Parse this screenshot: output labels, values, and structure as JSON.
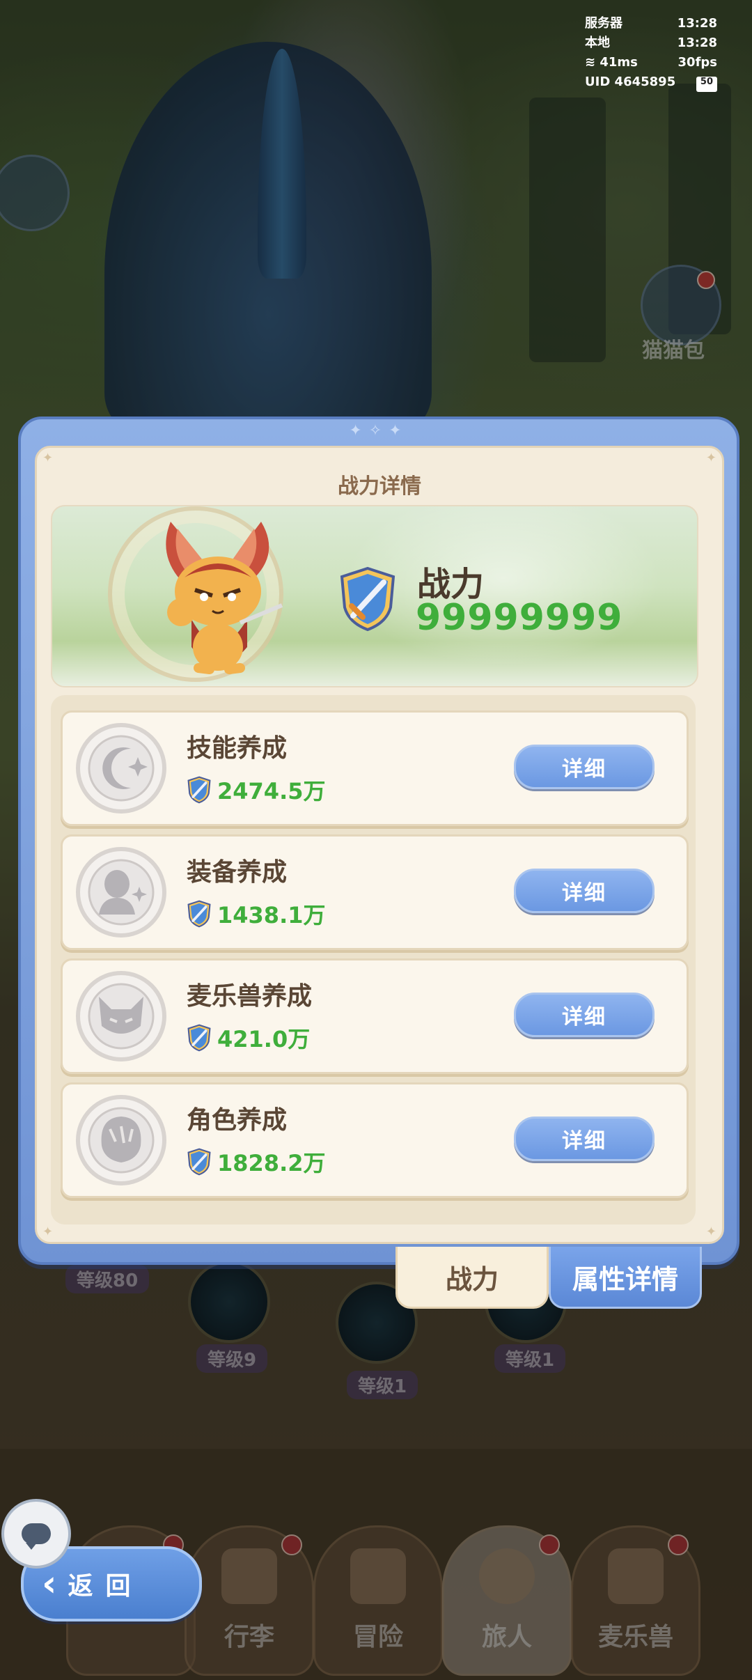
{
  "status": {
    "server_label": "服务器",
    "server_time": "13:28",
    "local_label": "本地",
    "local_time": "13:28",
    "ping": "41ms",
    "fps": "30fps",
    "uid_label": "UID",
    "uid": "4645895",
    "battery": "50"
  },
  "side": {
    "cat_bag_label": "猫猫包"
  },
  "panel": {
    "title": "战力详情",
    "power_label": "战力",
    "power_value": "99999999",
    "items": [
      {
        "name": "技能养成",
        "value": "2474.5万",
        "button": "详细",
        "icon": "moon-star-icon"
      },
      {
        "name": "装备养成",
        "value": "1438.1万",
        "button": "详细",
        "icon": "figure-sparkle-icon"
      },
      {
        "name": "麦乐兽养成",
        "value": "421.0万",
        "button": "详细",
        "icon": "fox-face-icon"
      },
      {
        "name": "角色养成",
        "value": "1828.2万",
        "button": "详细",
        "icon": "character-hair-icon"
      }
    ]
  },
  "tabs": {
    "power": "战力",
    "attributes": "属性详情"
  },
  "background": {
    "level_main": "等级80",
    "level_a": "等级9",
    "level_b": "等级1",
    "level_c": "等级1"
  },
  "back_button": "返回",
  "nav": [
    {
      "label": "行李"
    },
    {
      "label": "冒险"
    },
    {
      "label": "旅人"
    },
    {
      "label": "麦乐兽"
    }
  ],
  "colors": {
    "accent_blue": "#6b98e2",
    "power_green": "#3fae3b",
    "panel_cream": "#f4ecdc"
  }
}
